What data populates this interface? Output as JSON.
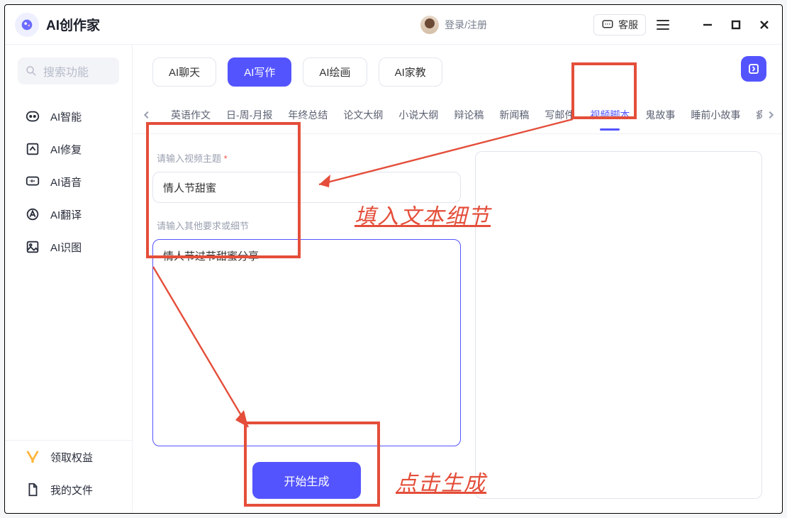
{
  "app": {
    "title": "AI创作家"
  },
  "header": {
    "login_text": "登录/注册",
    "support_label": "客服"
  },
  "sidebar": {
    "search_placeholder": "搜索功能",
    "items": [
      {
        "label": "AI智能"
      },
      {
        "label": "AI修复"
      },
      {
        "label": "AI语音"
      },
      {
        "label": "AI翻译"
      },
      {
        "label": "AI识图"
      }
    ],
    "bottom": [
      {
        "label": "领取权益"
      },
      {
        "label": "我的文件"
      }
    ]
  },
  "tabs": [
    {
      "label": "AI聊天",
      "active": false
    },
    {
      "label": "AI写作",
      "active": true
    },
    {
      "label": "AI绘画",
      "active": false
    },
    {
      "label": "AI家教",
      "active": false
    }
  ],
  "subtabs": [
    "英语作文",
    "日-周-月报",
    "年终总结",
    "论文大纲",
    "小说大纲",
    "辩论稿",
    "新闻稿",
    "写邮件",
    "视频脚本",
    "鬼故事",
    "睡前小故事",
    "疯狂"
  ],
  "subtab_active_index": 8,
  "form": {
    "topic_label": "请输入视频主题",
    "topic_required": "*",
    "topic_value": "情人节甜蜜",
    "detail_label": "请输入其他要求或细节",
    "detail_value": "情人节过节甜蜜分享",
    "generate_label": "开始生成"
  },
  "annotations": {
    "text1": "填入文本细节",
    "text2": "点击生成"
  }
}
